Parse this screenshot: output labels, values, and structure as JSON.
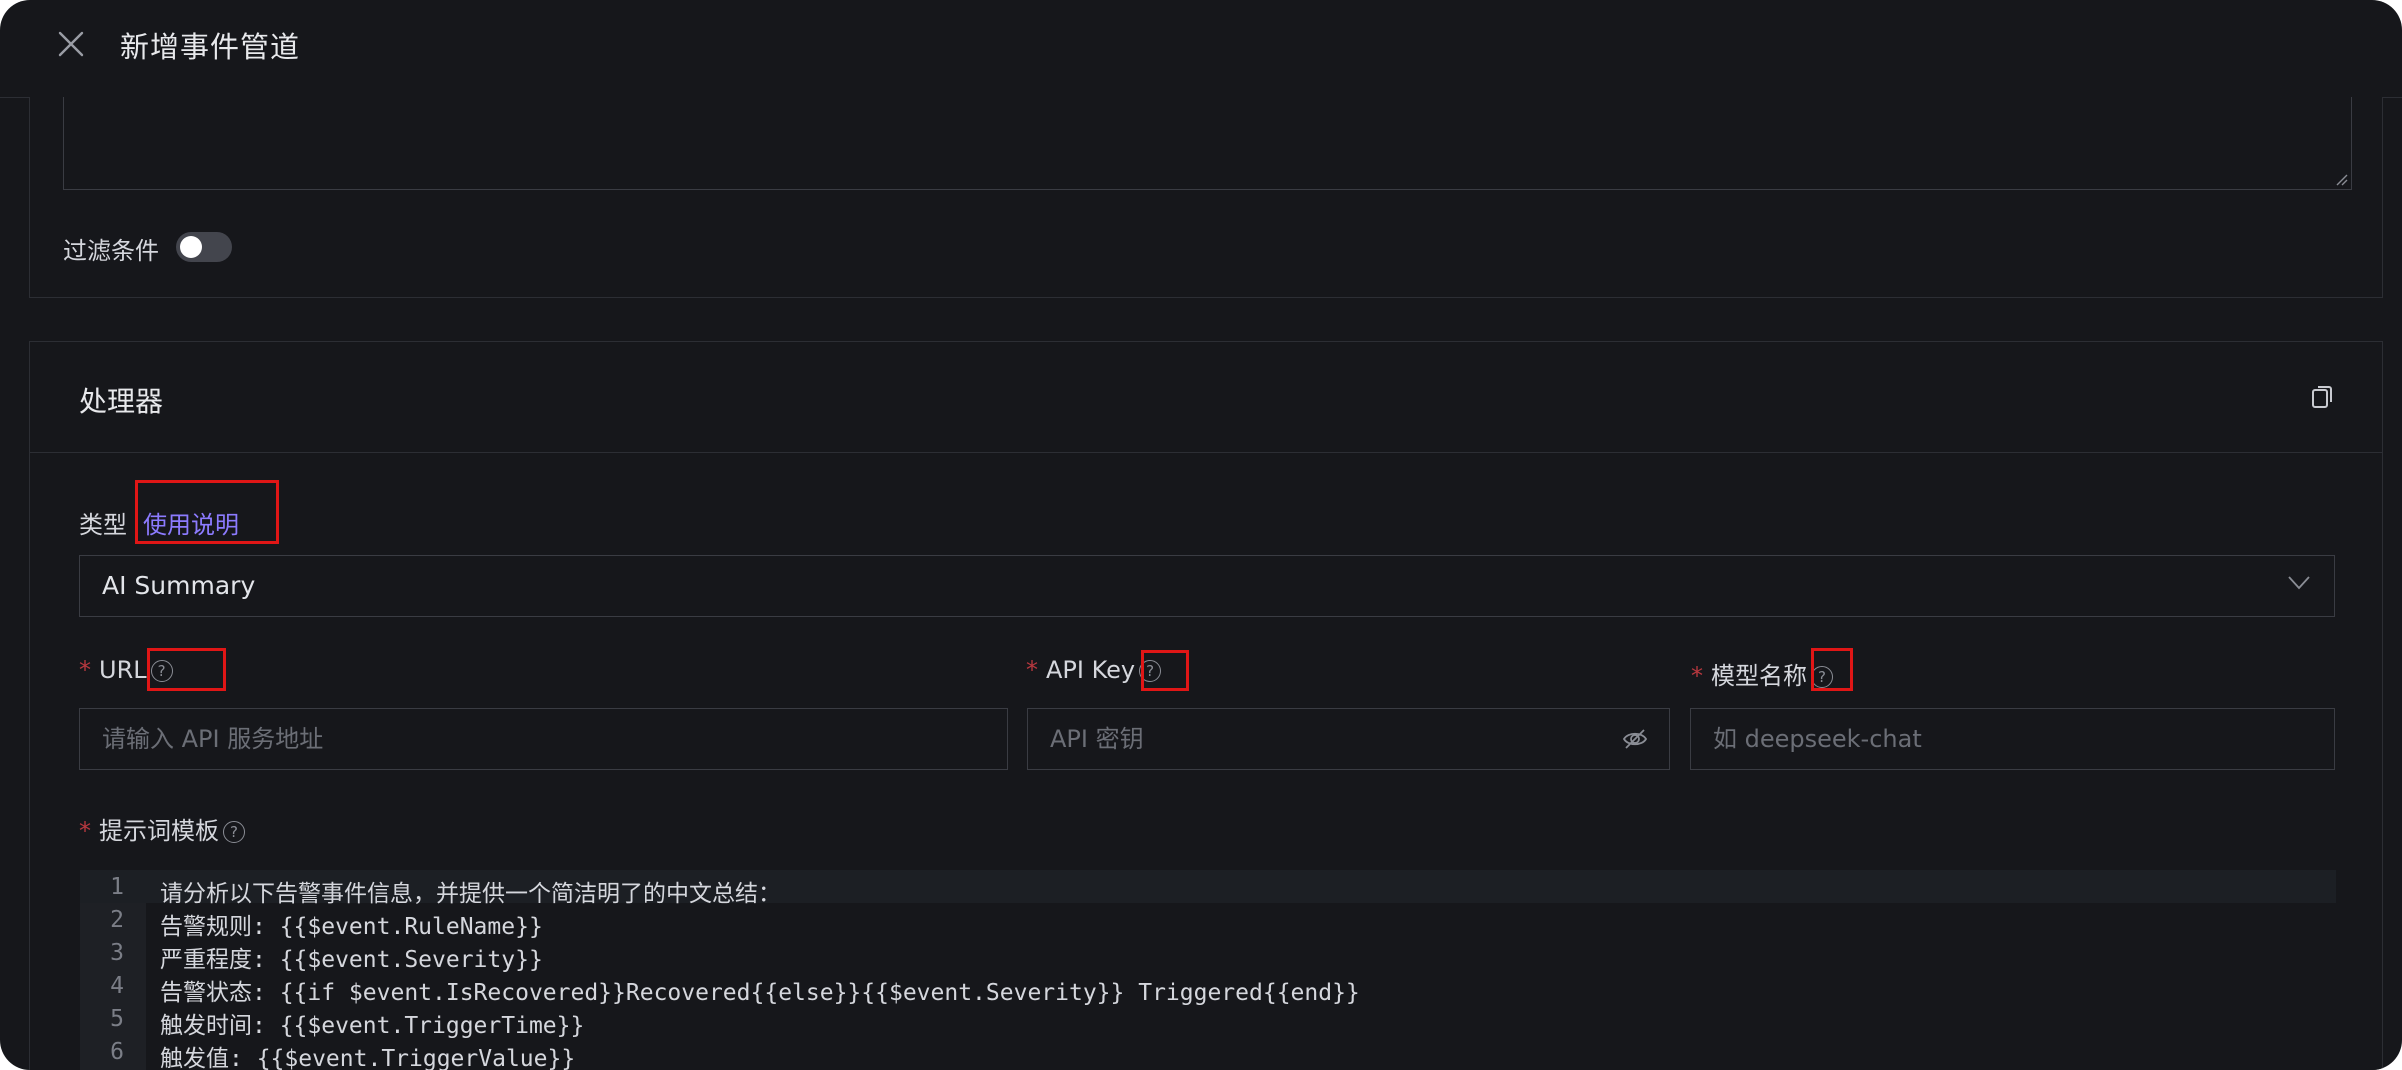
{
  "window": {
    "title": "新增事件管道"
  },
  "filter": {
    "label": "过滤条件",
    "enabled": false
  },
  "processor": {
    "title": "处理器",
    "type_label": "类型",
    "usage_link": "使用说明",
    "type_value": "AI Summary",
    "url": {
      "required_mark": "*",
      "label": "URL",
      "placeholder": "请输入 API 服务地址"
    },
    "api_key": {
      "required_mark": "*",
      "label": "API Key",
      "placeholder": "API 密钥"
    },
    "model": {
      "required_mark": "*",
      "label": "模型名称",
      "placeholder": "如 deepseek-chat"
    },
    "prompt": {
      "required_mark": "*",
      "label": "提示词模板",
      "lines": [
        {
          "no": "1",
          "text": "请分析以下告警事件信息，并提供一个简洁明了的中文总结："
        },
        {
          "no": "2",
          "text": "告警规则: {{$event.RuleName}}"
        },
        {
          "no": "3",
          "text": "严重程度: {{$event.Severity}}"
        },
        {
          "no": "4",
          "text": "告警状态: {{if $event.IsRecovered}}Recovered{{else}}{{$event.Severity}} Triggered{{end}}"
        },
        {
          "no": "5",
          "text": "触发时间: {{$event.TriggerTime}}"
        },
        {
          "no": "6",
          "text": "触发值: {{$event.TriggerValue}}"
        }
      ]
    }
  },
  "icons": {
    "close": "close-icon",
    "copy": "copy-icon",
    "help": "help-circle-icon",
    "chevron": "chevron-down-icon",
    "eye": "eye-off-icon",
    "resize": "resize-handle-icon"
  },
  "colors": {
    "accent_link": "#8c7bff",
    "required": "#b8383f",
    "highlight_box": "#e01616",
    "background": "#16171b"
  }
}
